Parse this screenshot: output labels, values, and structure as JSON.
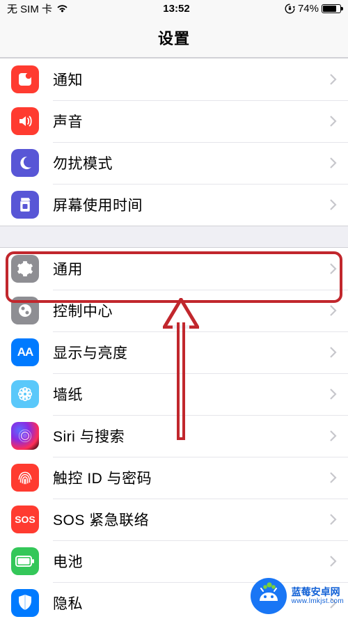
{
  "status": {
    "carrier": "无 SIM 卡",
    "time": "13:52",
    "battery_pct": "74%"
  },
  "nav": {
    "title": "设置"
  },
  "group1": [
    {
      "label": "通知",
      "icon": "notifications-icon",
      "bg": "bg-red"
    },
    {
      "label": "声音",
      "icon": "sounds-icon",
      "bg": "bg-red"
    },
    {
      "label": "勿扰模式",
      "icon": "do-not-disturb-icon",
      "bg": "bg-purple"
    },
    {
      "label": "屏幕使用时间",
      "icon": "screen-time-icon",
      "bg": "bg-purple"
    }
  ],
  "group2": [
    {
      "label": "通用",
      "icon": "general-icon",
      "bg": "bg-gray",
      "highlight": true
    },
    {
      "label": "控制中心",
      "icon": "control-centre-icon",
      "bg": "bg-gray"
    },
    {
      "label": "显示与亮度",
      "icon": "display-icon",
      "bg": "bg-blue",
      "text": "AA"
    },
    {
      "label": "墙纸",
      "icon": "wallpaper-icon",
      "bg": "bg-cyan"
    },
    {
      "label": "Siri 与搜索",
      "icon": "siri-icon",
      "bg": "bg-siri"
    },
    {
      "label": "触控 ID 与密码",
      "icon": "touch-id-icon",
      "bg": "bg-red"
    },
    {
      "label": "SOS 紧急联络",
      "icon": "sos-icon",
      "bg": "bg-red",
      "text": "SOS"
    },
    {
      "label": "电池",
      "icon": "battery-icon",
      "bg": "bg-green"
    },
    {
      "label": "隐私",
      "icon": "privacy-icon",
      "bg": "bg-lightblue"
    }
  ],
  "watermark": {
    "title": "蓝莓安卓网",
    "url": "www.lmkjst.com"
  }
}
